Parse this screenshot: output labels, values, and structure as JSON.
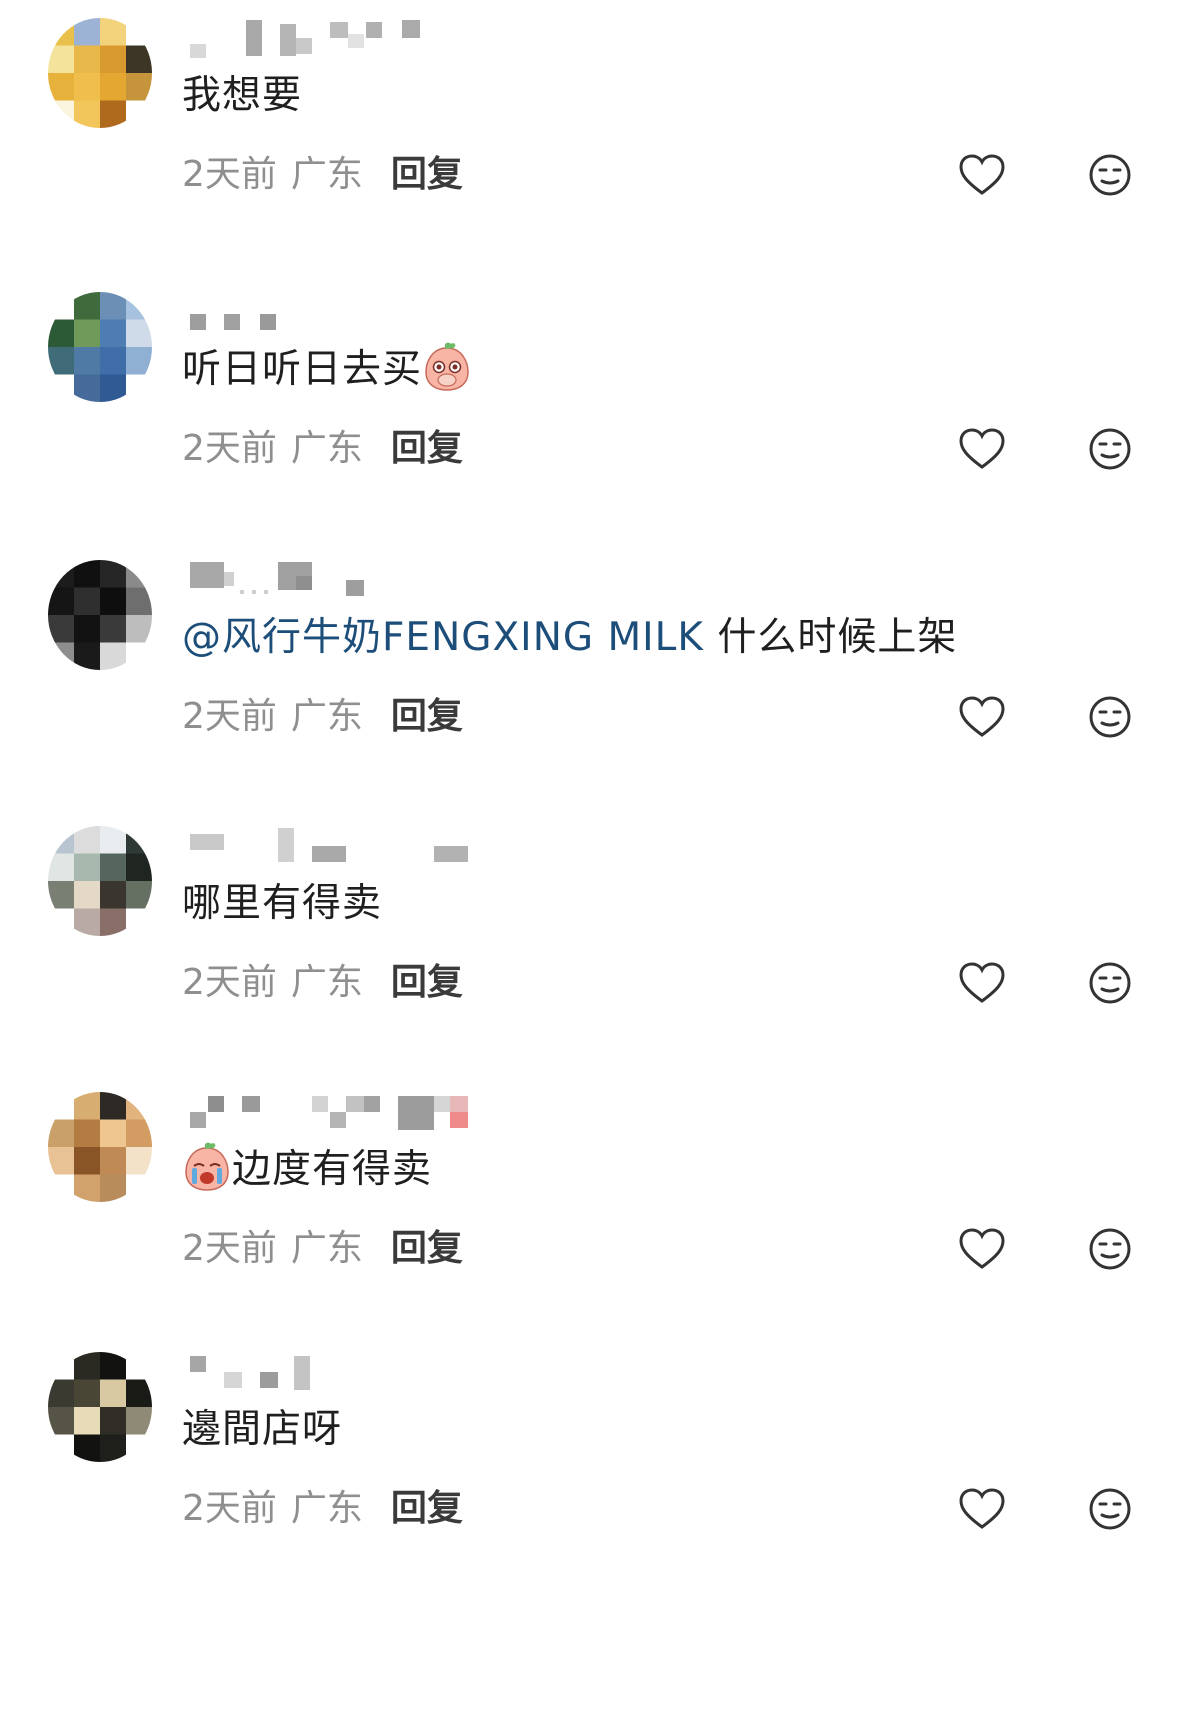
{
  "comments": [
    {
      "text": "我想要",
      "time": "2天前",
      "location": "广东",
      "reply_label": "回复",
      "emoji": null
    },
    {
      "text": "听日听日去买",
      "time": "2天前",
      "location": "广东",
      "reply_label": "回复",
      "emoji": "peach-covering-mouth-emoji"
    },
    {
      "mention": "@风行牛奶FENGXING MILK",
      "text": " 什么时候上架",
      "time": "2天前",
      "location": "广东",
      "reply_label": "回复",
      "emoji": null
    },
    {
      "text": "哪里有得卖",
      "time": "2天前",
      "location": "广东",
      "reply_label": "回复",
      "emoji": null
    },
    {
      "text": "边度有得卖",
      "time": "2天前",
      "location": "广东",
      "reply_label": "回复",
      "emoji": "peach-crying-emoji"
    },
    {
      "text": "邊間店呀",
      "time": "2天前",
      "location": "广东",
      "reply_label": "回复",
      "emoji": null
    }
  ],
  "colors": {
    "comment_text": "#1f1f1f",
    "mention": "#1d4e7a",
    "meta_text": "#8f8f8f",
    "reply_text": "#3a3a3a",
    "icon_stroke": "#333333"
  },
  "icons": {
    "like": "heart-outline-icon",
    "dislike": "meh-face-icon"
  }
}
